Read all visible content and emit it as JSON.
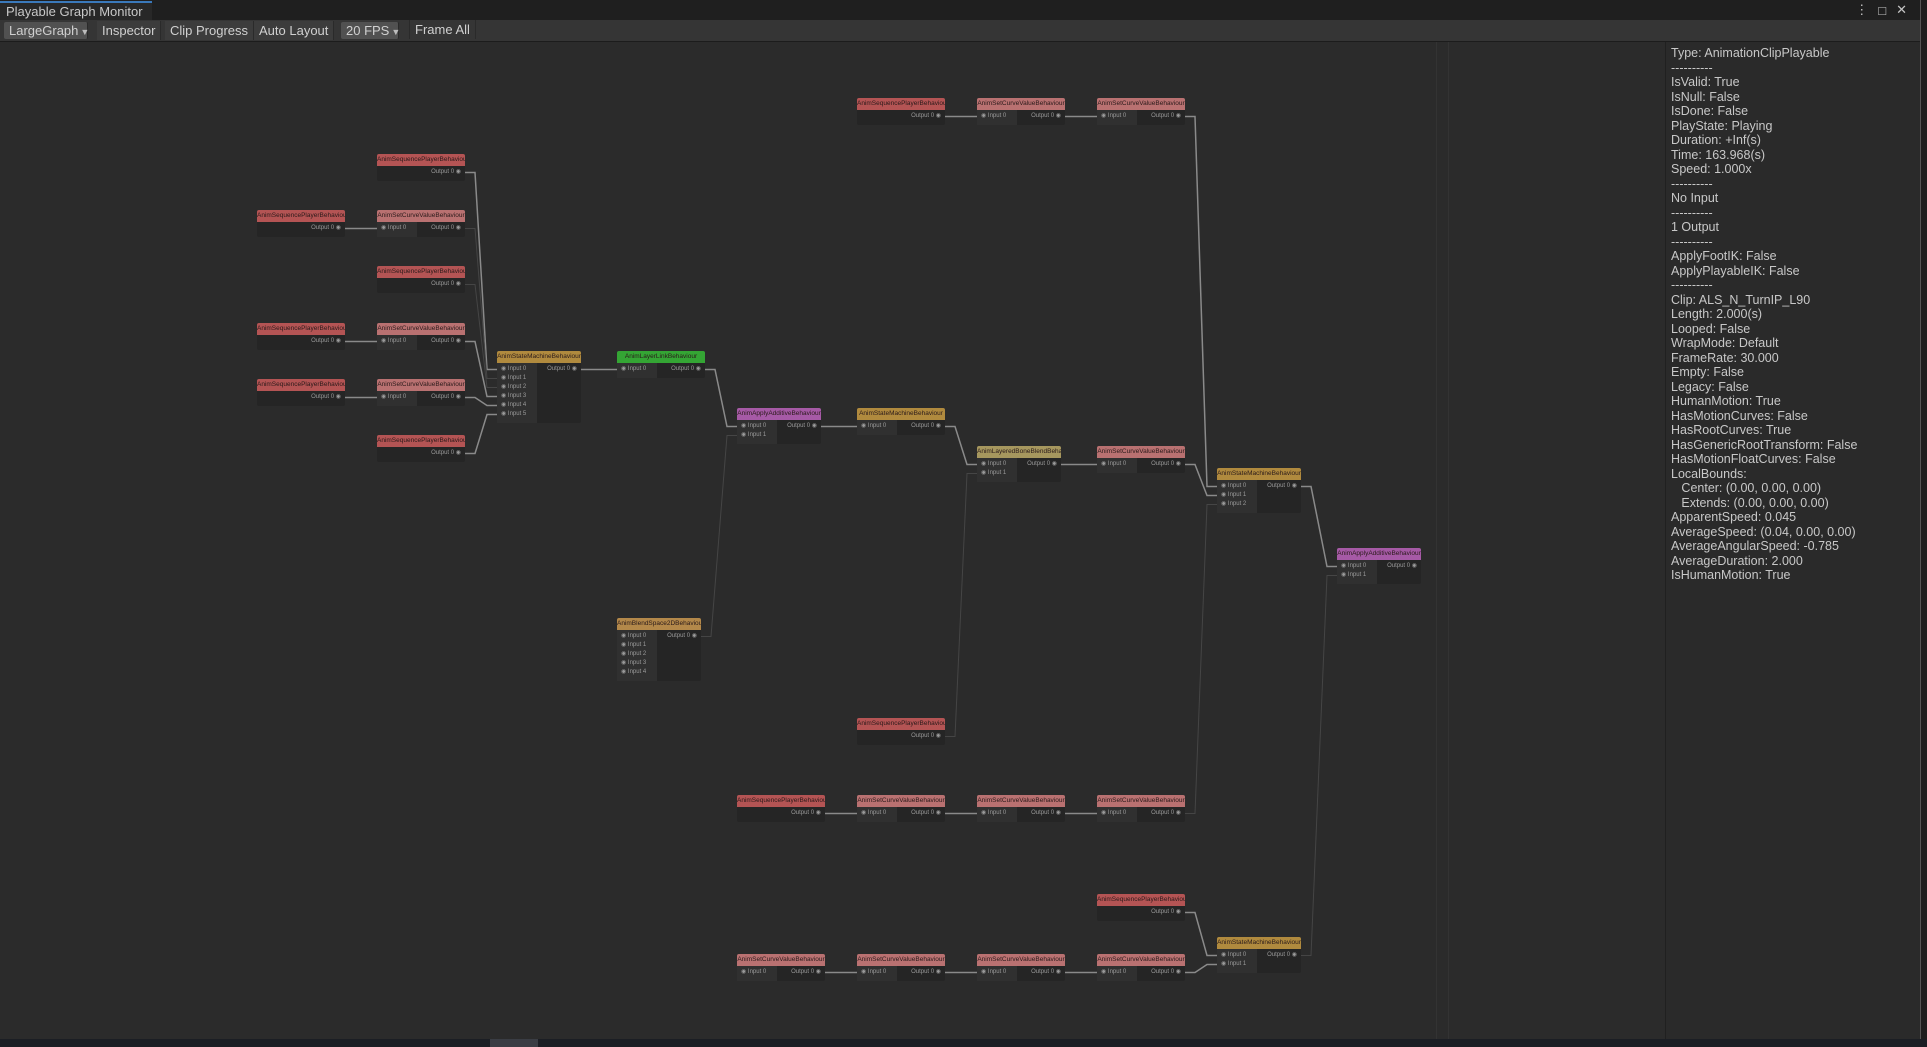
{
  "window": {
    "title": "Playable Graph Monitor",
    "controls": [
      "more-options",
      "maximize",
      "close"
    ]
  },
  "toolbar": {
    "graph_select": "LargeGraph",
    "inspector": "Inspector",
    "clip_progress": "Clip Progress",
    "auto_layout": "Auto Layout",
    "fps_select": "20 FPS",
    "frame_all": "Frame All"
  },
  "colors": {
    "sequence_player": "#b45454",
    "set_curve_value": "#b97171",
    "state_machine": "#b08a3e",
    "layer_link": "#34a534",
    "apply_additive": "#a65aa6",
    "layered_bone_blend": "#a6975e",
    "blend_space_2d": "#b3884a"
  },
  "nodes": [
    {
      "id": "n1",
      "type": "sequence_player",
      "title": "AnimSequencePlayerBehaviour",
      "inputs": [],
      "outputs": [
        "Output 0"
      ]
    },
    {
      "id": "n2",
      "type": "sequence_player",
      "title": "AnimSequencePlayerBehaviour",
      "inputs": [],
      "outputs": [
        "Output 0"
      ]
    },
    {
      "id": "n3",
      "type": "set_curve_value",
      "title": "AnimSetCurveValueBehaviour",
      "inputs": [
        "Input 0"
      ],
      "outputs": [
        "Output 0"
      ]
    },
    {
      "id": "n4",
      "type": "sequence_player",
      "title": "AnimSequencePlayerBehaviour",
      "inputs": [],
      "outputs": [
        "Output 0"
      ]
    },
    {
      "id": "n5",
      "type": "sequence_player",
      "title": "AnimSequencePlayerBehaviour",
      "inputs": [],
      "outputs": [
        "Output 0"
      ]
    },
    {
      "id": "n6",
      "type": "set_curve_value",
      "title": "AnimSetCurveValueBehaviour",
      "inputs": [
        "Input 0"
      ],
      "outputs": [
        "Output 0"
      ]
    },
    {
      "id": "n7",
      "type": "sequence_player",
      "title": "AnimSequencePlayerBehaviour",
      "inputs": [],
      "outputs": [
        "Output 0"
      ]
    },
    {
      "id": "n8",
      "type": "set_curve_value",
      "title": "AnimSetCurveValueBehaviour",
      "inputs": [
        "Input 0"
      ],
      "outputs": [
        "Output 0"
      ]
    },
    {
      "id": "n9",
      "type": "sequence_player",
      "title": "AnimSequencePlayerBehaviour",
      "inputs": [],
      "outputs": [
        "Output 0"
      ]
    },
    {
      "id": "n10",
      "type": "state_machine",
      "title": "AnimStateMachineBehaviour",
      "inputs": [
        "Input 0",
        "Input 1",
        "Input 2",
        "Input 3",
        "Input 4",
        "Input 5"
      ],
      "outputs": [
        "Output 0"
      ]
    },
    {
      "id": "n11",
      "type": "layer_link",
      "title": "AnimLayerLinkBehaviour",
      "inputs": [
        "Input 0"
      ],
      "outputs": [
        "Output 0"
      ]
    },
    {
      "id": "n12",
      "type": "apply_additive",
      "title": "AnimApplyAdditiveBehaviour",
      "inputs": [
        "Input 0",
        "Input 1"
      ],
      "outputs": [
        "Output 0"
      ]
    },
    {
      "id": "n13",
      "type": "state_machine",
      "title": "AnimStateMachineBehaviour",
      "inputs": [
        "Input 0"
      ],
      "outputs": [
        "Output 0"
      ]
    },
    {
      "id": "n14",
      "type": "layered_bone_blend",
      "title": "AnimLayeredBoneBlendBehaviour",
      "inputs": [
        "Input 0",
        "Input 1"
      ],
      "outputs": [
        "Output 0"
      ]
    },
    {
      "id": "n15",
      "type": "set_curve_value",
      "title": "AnimSetCurveValueBehaviour",
      "inputs": [
        "Input 0"
      ],
      "outputs": [
        "Output 0"
      ]
    },
    {
      "id": "n16",
      "type": "sequence_player",
      "title": "AnimSequencePlayerBehaviour",
      "inputs": [],
      "outputs": [
        "Output 0"
      ]
    },
    {
      "id": "n17",
      "type": "set_curve_value",
      "title": "AnimSetCurveValueBehaviour",
      "inputs": [
        "Input 0"
      ],
      "outputs": [
        "Output 0"
      ]
    },
    {
      "id": "n18",
      "type": "set_curve_value",
      "title": "AnimSetCurveValueBehaviour",
      "inputs": [
        "Input 0"
      ],
      "outputs": [
        "Output 0"
      ]
    },
    {
      "id": "n19",
      "type": "state_machine",
      "title": "AnimStateMachineBehaviour",
      "inputs": [
        "Input 0",
        "Input 1",
        "Input 2"
      ],
      "outputs": [
        "Output 0"
      ]
    },
    {
      "id": "n20",
      "type": "apply_additive",
      "title": "AnimApplyAdditiveBehaviour",
      "inputs": [
        "Input 0",
        "Input 1"
      ],
      "outputs": [
        "Output 0"
      ]
    },
    {
      "id": "n21",
      "type": "blend_space_2d",
      "title": "AnimBlendSpace2DBehaviour",
      "inputs": [
        "Input 0",
        "Input 1",
        "Input 2",
        "Input 3",
        "Input 4"
      ],
      "outputs": [
        "Output 0"
      ]
    },
    {
      "id": "n22",
      "type": "sequence_player",
      "title": "AnimSequencePlayerBehaviour",
      "inputs": [],
      "outputs": [
        "Output 0"
      ]
    },
    {
      "id": "n23",
      "type": "sequence_player",
      "title": "AnimSequencePlayerBehaviour",
      "inputs": [],
      "outputs": [
        "Output 0"
      ]
    },
    {
      "id": "n24",
      "type": "set_curve_value",
      "title": "AnimSetCurveValueBehaviour",
      "inputs": [
        "Input 0"
      ],
      "outputs": [
        "Output 0"
      ]
    },
    {
      "id": "n25",
      "type": "set_curve_value",
      "title": "AnimSetCurveValueBehaviour",
      "inputs": [
        "Input 0"
      ],
      "outputs": [
        "Output 0"
      ]
    },
    {
      "id": "n26",
      "type": "set_curve_value",
      "title": "AnimSetCurveValueBehaviour",
      "inputs": [
        "Input 0"
      ],
      "outputs": [
        "Output 0"
      ]
    },
    {
      "id": "n27",
      "type": "sequence_player",
      "title": "AnimSequencePlayerBehaviour",
      "inputs": [],
      "outputs": [
        "Output 0"
      ]
    },
    {
      "id": "n28",
      "type": "state_machine",
      "title": "AnimStateMachineBehaviour",
      "inputs": [
        "Input 0",
        "Input 1"
      ],
      "outputs": [
        "Output 0"
      ]
    },
    {
      "id": "n29",
      "type": "set_curve_value",
      "title": "AnimSetCurveValueBehaviour",
      "inputs": [
        "Input 0"
      ],
      "outputs": [
        "Output 0"
      ]
    },
    {
      "id": "n30",
      "type": "set_curve_value",
      "title": "AnimSetCurveValueBehaviour",
      "inputs": [
        "Input 0"
      ],
      "outputs": [
        "Output 0"
      ]
    },
    {
      "id": "n31",
      "type": "set_curve_value",
      "title": "AnimSetCurveValueBehaviour",
      "inputs": [
        "Input 0"
      ],
      "outputs": [
        "Output 0"
      ]
    },
    {
      "id": "n32",
      "type": "set_curve_value",
      "title": "AnimSetCurveValueBehaviour",
      "inputs": [
        "Input 0"
      ],
      "outputs": [
        "Output 0"
      ]
    }
  ],
  "edges": [
    [
      "n1",
      0,
      "n10",
      0
    ],
    [
      "n2",
      0,
      "n3",
      0
    ],
    [
      "n3",
      0,
      "n10",
      1
    ],
    [
      "n4",
      0,
      "n10",
      2
    ],
    [
      "n5",
      0,
      "n6",
      0
    ],
    [
      "n6",
      0,
      "n10",
      3
    ],
    [
      "n7",
      0,
      "n8",
      0
    ],
    [
      "n8",
      0,
      "n10",
      4
    ],
    [
      "n9",
      0,
      "n10",
      5
    ],
    [
      "n10",
      0,
      "n11",
      0
    ],
    [
      "n11",
      0,
      "n12",
      0
    ],
    [
      "n21",
      0,
      "n12",
      1
    ],
    [
      "n12",
      0,
      "n13",
      0
    ],
    [
      "n13",
      0,
      "n14",
      0
    ],
    [
      "n22",
      0,
      "n14",
      1
    ],
    [
      "n14",
      0,
      "n15",
      0
    ],
    [
      "n15",
      0,
      "n19",
      1
    ],
    [
      "n16",
      0,
      "n17",
      0
    ],
    [
      "n17",
      0,
      "n18",
      0
    ],
    [
      "n18",
      0,
      "n19",
      0
    ],
    [
      "n26",
      0,
      "n19",
      2
    ],
    [
      "n23",
      0,
      "n24",
      0
    ],
    [
      "n24",
      0,
      "n25",
      0
    ],
    [
      "n25",
      0,
      "n26",
      0
    ],
    [
      "n19",
      0,
      "n20",
      0
    ],
    [
      "n28",
      0,
      "n20",
      1
    ],
    [
      "n27",
      0,
      "n28",
      0
    ],
    [
      "n29",
      0,
      "n30",
      0
    ],
    [
      "n30",
      0,
      "n31",
      0
    ],
    [
      "n31",
      0,
      "n32",
      0
    ],
    [
      "n32",
      0,
      "n28",
      1
    ]
  ],
  "inspector": {
    "lines": [
      "Type: AnimationClipPlayable",
      "----------",
      "IsValid: True",
      "IsNull: False",
      "IsDone: False",
      "PlayState: Playing",
      "Duration: +Inf(s)",
      "Time: 163.968(s)",
      "Speed: 1.000x",
      "----------",
      "No Input",
      "----------",
      "1 Output",
      "----------",
      "ApplyFootIK: False",
      "ApplyPlayableIK: False",
      "----------",
      "Clip: ALS_N_TurnIP_L90",
      "Length: 2.000(s)",
      "Looped: False",
      "WrapMode: Default",
      "FrameRate: 30.000",
      "Empty: False",
      "Legacy: False",
      "HumanMotion: True",
      "HasMotionCurves: False",
      "HasRootCurves: True",
      "HasGenericRootTransform: False",
      "HasMotionFloatCurves: False",
      "LocalBounds:",
      "   Center: (0.00, 0.00, 0.00)",
      "   Extends: (0.00, 0.00, 0.00)",
      "ApparentSpeed: 0.045",
      "AverageSpeed: (0.04, 0.00, 0.00)",
      "AverageAngularSpeed: -0.785",
      "AverageDuration: 2.000",
      "IsHumanMotion: True"
    ]
  }
}
